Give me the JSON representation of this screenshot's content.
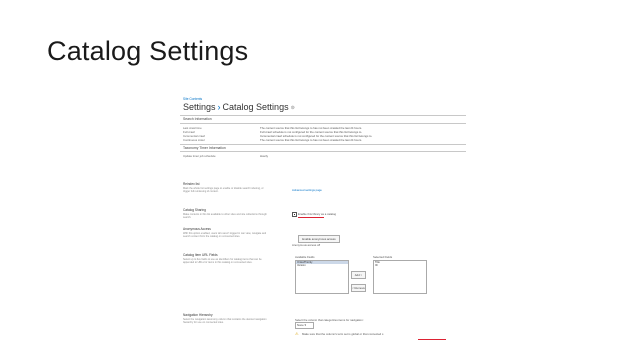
{
  "slide": {
    "title": "Catalog Settings"
  },
  "breadcrumb": {
    "parent": "Site Contents",
    "sep": "›",
    "current": "Catalog Settings"
  },
  "search_info": {
    "title": "Search Information",
    "rows": [
      {
        "label": "Last crawl time",
        "value": "The content source that this list belongs to has not been crawled the last 24 hours."
      },
      {
        "label": "Full crawl",
        "value": "Full crawl schedule is not configured for the content source that this list belongs to."
      },
      {
        "label": "Incremental crawl",
        "value": "Incremental crawl schedule is not configured for the content source that this list belongs to."
      },
      {
        "label": "Continuous crawl",
        "value": "The content source that this list belongs to has not been crawled the last 24 hours."
      }
    ]
  },
  "taxonomy": {
    "title": "Taxonomy Timer Information",
    "row_label": "Update timer job schedule",
    "row_value": "Hourly"
  },
  "reindex": {
    "title": "Reindex list",
    "desc": "Mark the whole list settings page to enable or disable search indexing, or trigger full reindexing of content.",
    "link": "Advanced settings page"
  },
  "sharing": {
    "title": "Catalog Sharing",
    "desc": "Make contents in this list available to other sites and site collections through search.",
    "checkbox_label": "Enable this library as a catalog"
  },
  "anon": {
    "title": "Anonymous Access",
    "desc": "With this option enabled, users who aren't logged in can view, navigate and search content from the catalog on connected sites.",
    "button": "Enable anonymous access",
    "status": "Anonymous access off"
  },
  "url_fields": {
    "title": "Catalog Item URL Fields",
    "desc": "Select up to five fields to use as identifiers for catalog items that can be appended to URLs for items in this catalog on connected sites.",
    "available_label": "Available Fields",
    "available": [
      "Order/Priority",
      "Version"
    ],
    "selected_label": "Selected Fields",
    "selected": [
      "Title",
      "ID"
    ],
    "add": "Add >",
    "remove": "< Remove"
  },
  "nav_hierarchy": {
    "title": "Navigation Hierarchy",
    "desc": "Select the navigation taxonomy column that contains the desired navigation hierarchy for use on connected sites.",
    "select_label": "Select the column that categorizes items for navigation:",
    "select_value": "None",
    "warning": "Make sure that the column's term set is global or that connected s"
  },
  "colors": {
    "link": "#0072c6",
    "annotation": "#dd2233"
  }
}
